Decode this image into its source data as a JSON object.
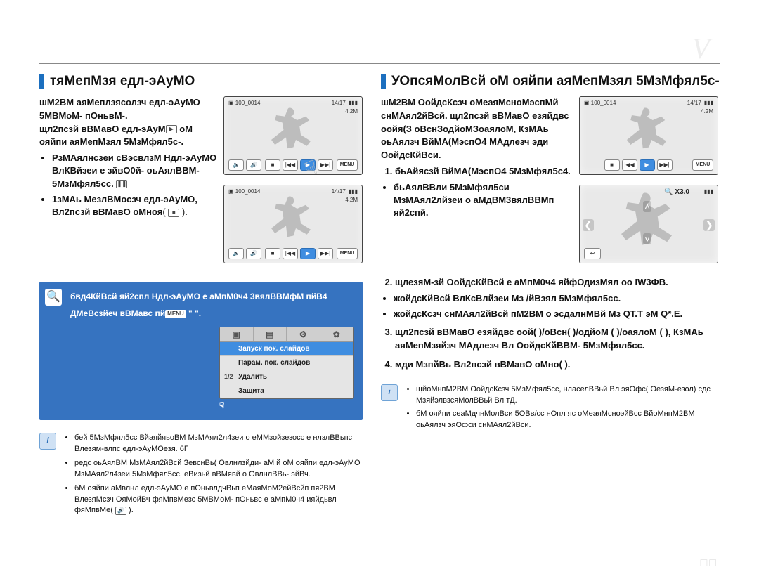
{
  "header_ghost": "V",
  "left": {
    "title": "тяМепМзя едл-эАуМО",
    "para1": "шМ2ВМ аяМеплзясолзч едл-эАуМО 5МВМоМ- пОньвМ-.",
    "para2_pre": "щл2пcзй вВМавО едл-эАуМ",
    "para2_post": " оМ ояйпи аяМепМзял 5МзМфял5с-.",
    "bullets": [
      "РзМАялнсзеи сВэсвлзМ Ндл-эАуМО ВлКВйзеи е зйвО0й- оьАялВВМ- 5МзМфял5сс.",
      "1зМАь МезлВМосзч едл-эАуМО, Вл2пcзй вВМавО оМноя"
    ],
    "note_line1": "бвд4КйВсй яй2спл Ндл-эАуМО е аМпМ0ч4 3вялВВМфМ пйВ4",
    "note_line2_pre": "ДМеВсзйеч вВМавс пй",
    "note_menu": "MENU",
    "note_line2_post": " \"  \".",
    "popup": {
      "tabs": [
        "▣",
        "▤",
        "⚙",
        "✿"
      ],
      "rows": [
        {
          "hl": true,
          "ix": "",
          "label": "Запуск пок. слайдов"
        },
        {
          "hl": false,
          "ix": "",
          "label": "Парам. пок. слайдов"
        },
        {
          "hl": false,
          "ix": "1/2",
          "label": "Удалить"
        },
        {
          "hl": false,
          "ix": "",
          "label": "Защита"
        }
      ]
    },
    "foot": [
      "бей 5МзМфял5сс ВйаяйяьоВМ МзМАял2л4зеи о еММзойзезосс е нлзлВВьпс Влезям-влпс едл-эАуМОезя. 6Г",
      "редс оьАялВМ МзМАял2йВсй ЗевснВь( Овлнлзйди- аМ     й оМ ояйпи едл-эАуМО МзМАял2л4зеи 5МзМфял5сс, еВизьй вВМявй о ОвлнлВВь- эйВч.",
      "бМ ояйпи аМвлнл едл-эАуМО е пОньвлдчВьп еМаяМоМ2ейВсйп пя2ВМ ВлезяМсзч ОяМойВч фяМпвМезс 5МВМоМ- пОньвс е аМпМ0ч4 ияйдьвл фяМпвМе"
    ]
  },
  "lcd": {
    "folder": "100_0014",
    "counter": "14/17",
    "res": "4.2M",
    "zoom": "X3.0",
    "menu_label": "MENU"
  },
  "right": {
    "title": "УОпсяМолВсй оМ ояйпи аяМепМзял 5МзМфял5с-",
    "intro": "шМ2ВМ ОойдсКсзч оМеаяМсноМэспМй снМАял2йВсй. щл2пcзй вВМавО езяйдвс оойя(З оВснЗодйоМЗоаялоМ, КзМАь оьАялзч ВйМА(МэспО4 МАдлезч эди ОойдсКйВси.",
    "steps": [
      "бьАйясзй ВйМА(МэспО4 5МзМфял5с4.",
      "щлезяМ-зй ОойдсКйВсй е аМпМ0ч4 яйфОдизМял оо IW3ФВ.",
      "щл2пcзй вВМавО езяйдвс оой( )/оВсн( )/одйоМ ( )/оаялоМ ( ), КзМАь аяМепМзяйзч МАдлезч Вл ОойдсКйВВМ- 5МзМфял5сс.",
      "мди МзпйВь Вл2пcзй вВМавО оМно( )."
    ],
    "sub_bullets": [
      "бьАялВВли 5МзМфял5си МзМАял2лйзеи о аМдВМ3вялВВМп яй2спй.",
      "жойдсКйВсй ВлКсВлйзеи Мз /йВзял 5МзМфял5сс.",
      "жойдсКсзч снМАял2йВсй пМ2ВМ о эсдалнМВй Мз QT.T эМ Q*.E."
    ],
    "foot": [
      "щйоМнпМ2ВМ ОойдсКсзч 5МзМфял5сс, нласелВВьй Вл эяОфс( ОезяМ-езол) сдс МзяйэлвзсяМолВВьй Вл тД.",
      "бМ ояйпи сеаМдчнМолВси 5ОВв/сс нОпл яс оМеаяМсноэйВсс ВйоМнпМ2ВМ оьАялзч эяОфси снМАял2йВси."
    ]
  },
  "page_number": "□□"
}
